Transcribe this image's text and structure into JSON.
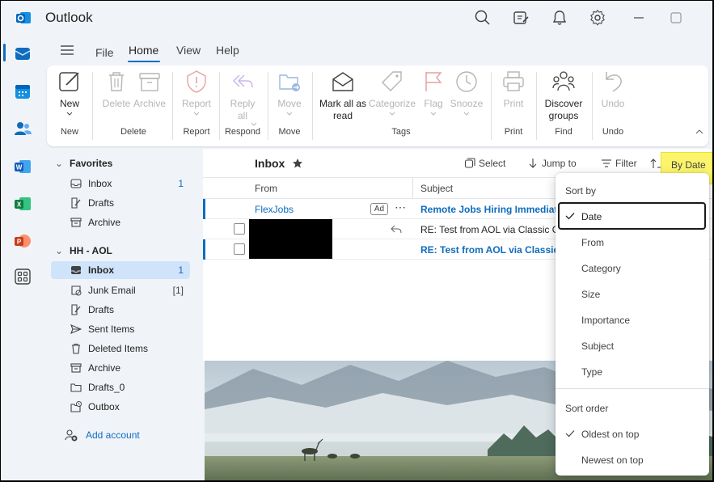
{
  "app": {
    "title": "Outlook",
    "logo_icon": "outlook-logo-icon",
    "accent": "#0f6cbd"
  },
  "titlebar_icons": [
    "search-icon",
    "compose-icon",
    "bell-icon",
    "gear-icon",
    "minimize-icon",
    "maximize-icon"
  ],
  "rail": [
    "mail-icon",
    "calendar-icon",
    "people-icon",
    "word-icon",
    "excel-icon",
    "powerpoint-icon",
    "apps-icon"
  ],
  "tabs": [
    "File",
    "Home",
    "View",
    "Help"
  ],
  "ribbon": {
    "new": {
      "label": "New",
      "group": "New"
    },
    "delete": {
      "label": "Delete"
    },
    "archive": {
      "label": "Archive"
    },
    "delete_group": "Delete",
    "report": {
      "label": "Report",
      "group": "Report"
    },
    "reply_all": {
      "line1": "Reply",
      "line2": "all",
      "group": "Respond"
    },
    "move": {
      "label": "Move",
      "group": "Move"
    },
    "mark_all_read": {
      "line1": "Mark all as",
      "line2": "read"
    },
    "categorize": {
      "label": "Categorize"
    },
    "flag": {
      "label": "Flag"
    },
    "snooze": {
      "label": "Snooze"
    },
    "tags_group": "Tags",
    "print": {
      "label": "Print",
      "group": "Print"
    },
    "discover": {
      "line1": "Discover",
      "line2": "groups",
      "group": "Find"
    },
    "undo": {
      "label": "Undo",
      "group": "Undo"
    }
  },
  "folders": {
    "favorites": {
      "label": "Favorites",
      "items": [
        {
          "label": "Inbox",
          "count": "1"
        },
        {
          "label": "Drafts",
          "count": ""
        },
        {
          "label": "Archive",
          "count": ""
        }
      ]
    },
    "account": {
      "label": "HH - AOL",
      "items": [
        {
          "label": "Inbox",
          "count": "1"
        },
        {
          "label": "Junk Email",
          "count": "[1]"
        },
        {
          "label": "Drafts",
          "count": ""
        },
        {
          "label": "Sent Items",
          "count": ""
        },
        {
          "label": "Deleted Items",
          "count": ""
        },
        {
          "label": "Archive",
          "count": ""
        },
        {
          "label": "Drafts_0",
          "count": ""
        },
        {
          "label": "Outbox",
          "count": ""
        }
      ]
    },
    "add_account": "Add account"
  },
  "message_list": {
    "title": "Inbox",
    "tools": {
      "select": "Select",
      "jump_to": "Jump to",
      "filter": "Filter",
      "sort": "By Date"
    },
    "columns": {
      "from": "From",
      "subject": "Subject"
    },
    "rows": [
      {
        "from": "FlexJobs",
        "badge": "Ad",
        "subject": "Remote Jobs Hiring Immediately",
        "unread": true
      },
      {
        "from": "",
        "subject": "RE: Test from AOL via Classic Outlook",
        "unread": false
      },
      {
        "from": "",
        "subject": "RE: Test from AOL via Classic Outlook",
        "unread": true
      }
    ]
  },
  "sort_menu": {
    "sort_by_label": "Sort by",
    "sort_by": [
      {
        "label": "Date",
        "checked": true
      },
      {
        "label": "From",
        "checked": false
      },
      {
        "label": "Category",
        "checked": false
      },
      {
        "label": "Size",
        "checked": false
      },
      {
        "label": "Importance",
        "checked": false
      },
      {
        "label": "Subject",
        "checked": false
      },
      {
        "label": "Type",
        "checked": false
      }
    ],
    "sort_order_label": "Sort order",
    "sort_order": [
      {
        "label": "Oldest on top",
        "checked": true
      },
      {
        "label": "Newest on top",
        "checked": false
      }
    ]
  }
}
